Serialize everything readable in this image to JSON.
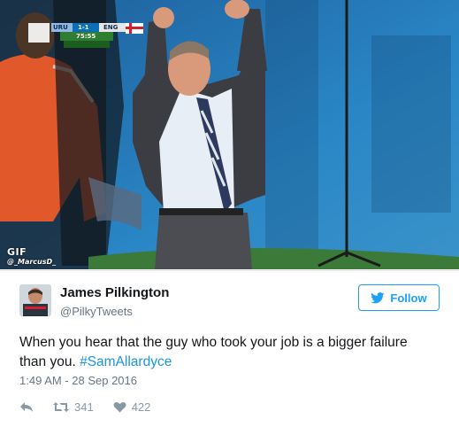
{
  "media": {
    "score": {
      "home": "URU",
      "score": "1-1",
      "away": "ENG",
      "clock": "75:55",
      "subline": ""
    },
    "gif_badge": "GIF",
    "credit": "@_MarcusD_"
  },
  "tweet": {
    "author_name": "James Pilkington",
    "author_handle": "@PilkyTweets",
    "follow_label": "Follow",
    "text": "When you hear that the guy who took your job is a bigger failure than you. ",
    "hashtag": "#SamAllardyce",
    "timestamp": "1:49 AM - 28 Sep 2016",
    "retweets": "341",
    "likes": "422"
  },
  "colors": {
    "accent": "#1da1f2",
    "hashtag": "#1b95e0",
    "muted": "#657786"
  },
  "icons": [
    "bird-icon",
    "reply-icon",
    "retweet-icon",
    "heart-icon"
  ]
}
